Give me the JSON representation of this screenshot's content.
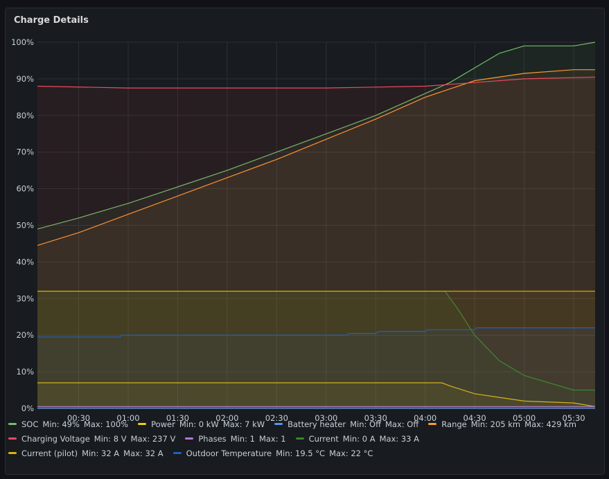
{
  "panel": {
    "title": "Charge Details"
  },
  "chart_data": {
    "type": "line",
    "x": {
      "min": "00:05",
      "max": "05:43",
      "ticks": [
        "00:30",
        "01:00",
        "01:30",
        "02:00",
        "02:30",
        "03:00",
        "03:30",
        "04:00",
        "04:30",
        "05:00",
        "05:30"
      ]
    },
    "y": {
      "min": 0,
      "max": 100,
      "tick_labels": [
        "0%",
        "10%",
        "20%",
        "30%",
        "40%",
        "50%",
        "60%",
        "70%",
        "80%",
        "90%",
        "100%"
      ]
    },
    "grid": true,
    "legend_placement": "bottom",
    "series": [
      {
        "name": "SOC",
        "color": "#73bf69",
        "min_label": "Min: 49%",
        "max_label": "Max: 100%",
        "points": [
          [
            "00:05",
            49
          ],
          [
            "00:30",
            52
          ],
          [
            "01:00",
            56
          ],
          [
            "01:30",
            60.5
          ],
          [
            "02:00",
            65
          ],
          [
            "02:30",
            70
          ],
          [
            "03:00",
            75
          ],
          [
            "03:30",
            80
          ],
          [
            "04:00",
            86
          ],
          [
            "04:15",
            89
          ],
          [
            "04:30",
            93
          ],
          [
            "04:45",
            97
          ],
          [
            "05:00",
            99
          ],
          [
            "05:30",
            99
          ],
          [
            "05:43",
            100
          ]
        ]
      },
      {
        "name": "Power",
        "color": "#f2cc0c",
        "min_label": "Min: 0 kW",
        "max_label": "Max: 7 kW",
        "points": [
          [
            "00:05",
            7
          ],
          [
            "04:10",
            7
          ],
          [
            "04:16",
            6
          ],
          [
            "04:30",
            4
          ],
          [
            "04:45",
            3
          ],
          [
            "05:00",
            2
          ],
          [
            "05:30",
            1.5
          ],
          [
            "05:43",
            0.5
          ]
        ]
      },
      {
        "name": "Battery heater",
        "color": "#5794f2",
        "min_label": "Min: Off",
        "max_label": "Max: Off",
        "points": [
          [
            "00:05",
            0
          ],
          [
            "05:43",
            0
          ]
        ]
      },
      {
        "name": "Range",
        "color": "#ff9830",
        "min_label": "Min: 205 km",
        "max_label": "Max: 429 km",
        "points": [
          [
            "00:05",
            44.5
          ],
          [
            "00:30",
            48
          ],
          [
            "01:00",
            53
          ],
          [
            "01:30",
            58
          ],
          [
            "02:00",
            63
          ],
          [
            "02:30",
            68
          ],
          [
            "03:00",
            73.5
          ],
          [
            "03:30",
            79
          ],
          [
            "04:00",
            85
          ],
          [
            "04:30",
            89.5
          ],
          [
            "05:00",
            91.5
          ],
          [
            "05:30",
            92.5
          ],
          [
            "05:43",
            92.5
          ]
        ]
      },
      {
        "name": "Charging Voltage",
        "color": "#f2495c",
        "min_label": "Min: 8 V",
        "max_label": "Max: 237 V",
        "points": [
          [
            "00:05",
            88
          ],
          [
            "01:00",
            87.5
          ],
          [
            "02:00",
            87.5
          ],
          [
            "03:00",
            87.5
          ],
          [
            "04:00",
            88
          ],
          [
            "04:30",
            89
          ],
          [
            "05:00",
            90
          ],
          [
            "05:43",
            90.5
          ]
        ]
      },
      {
        "name": "Phases",
        "color": "#b877d9",
        "min_label": "Min: 1",
        "max_label": "Max: 1",
        "points": [
          [
            "00:05",
            0.5
          ],
          [
            "05:43",
            0.5
          ]
        ]
      },
      {
        "name": "Current",
        "color": "#37872d",
        "min_label": "Min: 0 A",
        "max_label": "Max: 33 A",
        "points": [
          [
            "00:05",
            32
          ],
          [
            "04:12",
            32
          ],
          [
            "04:20",
            27
          ],
          [
            "04:30",
            20
          ],
          [
            "04:45",
            13
          ],
          [
            "05:00",
            9
          ],
          [
            "05:15",
            7
          ],
          [
            "05:30",
            5
          ],
          [
            "05:43",
            5
          ]
        ]
      },
      {
        "name": "Current (pilot)",
        "color": "#e0b400",
        "min_label": "Min: 32 A",
        "max_label": "Max: 32 A",
        "points": [
          [
            "00:05",
            32
          ],
          [
            "05:43",
            32
          ]
        ]
      },
      {
        "name": "Outdoor Temperature",
        "color": "#1f60c4",
        "min_label": "Min: 19.5 °C",
        "max_label": "Max: 22 °C",
        "points": [
          [
            "00:05",
            19.5
          ],
          [
            "00:55",
            19.5
          ],
          [
            "00:56",
            20
          ],
          [
            "03:12",
            20
          ],
          [
            "03:14",
            20.5
          ],
          [
            "03:30",
            20.5
          ],
          [
            "03:32",
            21
          ],
          [
            "04:00",
            21
          ],
          [
            "04:01",
            21.5
          ],
          [
            "04:30",
            21.5
          ],
          [
            "04:31",
            22
          ],
          [
            "05:43",
            22
          ]
        ]
      }
    ]
  }
}
